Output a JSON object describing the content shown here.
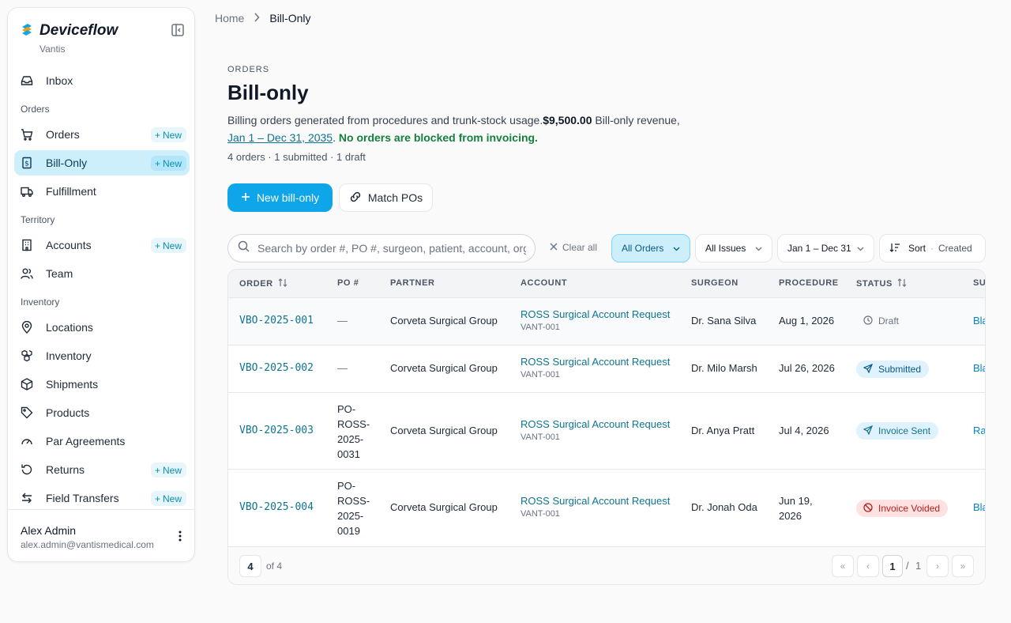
{
  "sidebar": {
    "brand": "Deviceflow",
    "org": "Vantis",
    "new_label": "New",
    "items": [
      {
        "label": "Inbox"
      },
      {
        "section": "Orders"
      },
      {
        "label": "Orders"
      },
      {
        "label": "Bill-Only"
      },
      {
        "label": "Fulfillment"
      },
      {
        "section": "Territory"
      },
      {
        "label": "Accounts"
      },
      {
        "label": "Team"
      },
      {
        "section": "Inventory"
      },
      {
        "label": "Locations"
      },
      {
        "label": "Inventory"
      },
      {
        "label": "Shipments"
      },
      {
        "label": "Products"
      },
      {
        "label": "Par Agreements"
      },
      {
        "label": "Returns"
      },
      {
        "label": "Field Transfers"
      }
    ],
    "user": {
      "name": "Alex Admin",
      "email": "alex.admin@vantismedical.com"
    }
  },
  "breadcrumb": {
    "home": "Home",
    "current": "Bill-Only"
  },
  "header": {
    "eyebrow": "ORDERS",
    "title": "Bill-only",
    "desc_text": "Billing orders generated from procedures and trunk-stock usage.",
    "revenue_amount": "$9,500.00",
    "revenue_label": " Bill-only revenue,",
    "date_range": "Jan 1 – Dec 31, 2035",
    "blocked_note": "No orders are blocked from invoicing.",
    "meta": "4 orders · 1 submitted · 1 draft"
  },
  "actions": {
    "new_bill_only": "New bill-only",
    "match_pos": "Match POs"
  },
  "filters": {
    "search_placeholder": "Search by order #, PO #, surgeon, patient, account, org",
    "clear_all": "Clear all",
    "all_orders": "All Orders",
    "all_issues": "All Issues",
    "date": "Jan 1 – Dec 31",
    "sort": "Sort",
    "sort_field": "Created"
  },
  "table": {
    "columns": [
      "ORDER",
      "PO #",
      "PARTNER",
      "ACCOUNT",
      "SURGEON",
      "PROCEDURE",
      "STATUS",
      "SU"
    ],
    "rows": [
      {
        "order": "VBO-2025-001",
        "po": "—",
        "partner": "Corveta Surgical Group",
        "account": "ROSS Surgical Account Request",
        "account_code": "VANT-001",
        "surgeon": "Dr. Sana Silva",
        "procedure": "Aug 1, 2026",
        "status": "Draft",
        "supplier": "Bla"
      },
      {
        "order": "VBO-2025-002",
        "po": "—",
        "partner": "Corveta Surgical Group",
        "account": "ROSS Surgical Account Request",
        "account_code": "VANT-001",
        "surgeon": "Dr. Milo Marsh",
        "procedure": "Jul 26, 2026",
        "status": "Submitted",
        "supplier": "Bla"
      },
      {
        "order": "VBO-2025-003",
        "po": "PO-\nROSS-\n2025-\n0031",
        "partner": "Corveta Surgical Group",
        "account": "ROSS Surgical Account Request",
        "account_code": "VANT-001",
        "surgeon": "Dr. Anya Pratt",
        "procedure": "Jul 4, 2026",
        "status": "Invoice Sent",
        "supplier": "Ra"
      },
      {
        "order": "VBO-2025-004",
        "po": "PO-\nROSS-\n2025-\n0019",
        "partner": "Corveta Surgical Group",
        "account": "ROSS Surgical Account Request",
        "account_code": "VANT-001",
        "surgeon": "Dr. Jonah Oda",
        "procedure": "Jun 19,\n2026",
        "status": "Invoice Voided",
        "supplier": "Bla"
      }
    ]
  },
  "pagination": {
    "count": "4",
    "of_total": "of 4",
    "current_page": "1",
    "separator": "/",
    "total_pages": "1"
  }
}
